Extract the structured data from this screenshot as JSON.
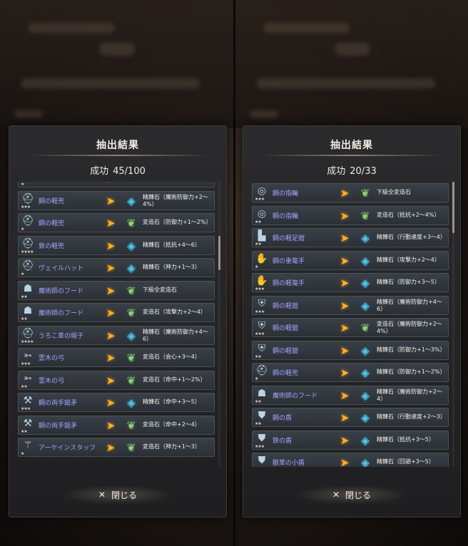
{
  "left_panel": {
    "title": "抽出結果",
    "success_label": "成功",
    "success_count": "45/100",
    "close_label": "閉じる",
    "rows": [
      {
        "icon": "helmet-icon",
        "stars": "★",
        "name": "鋼の軽兜",
        "mat": "plant",
        "result": ""
      },
      {
        "icon": "helmet-icon",
        "stars": "★★★",
        "name": "鋼の軽兜",
        "mat": "gem",
        "result": "精錬石（魔術防御力+2～4%）"
      },
      {
        "icon": "helmet-icon",
        "stars": "★",
        "name": "鋼の軽兜",
        "mat": "plant",
        "result": "変造石（防御力+1～2%）"
      },
      {
        "icon": "helmet-icon",
        "stars": "★★★★",
        "name": "鉄の軽兜",
        "mat": "gem",
        "result": "精錬石（抵抗+4～6）"
      },
      {
        "icon": "helmet-icon",
        "stars": "★",
        "name": "ヴェイルハット",
        "mat": "gem",
        "result": "精錬石（神力+1～3）"
      },
      {
        "icon": "hood-icon",
        "stars": "★★",
        "name": "魔術師のフード",
        "mat": "plant",
        "result": "下級全変造石"
      },
      {
        "icon": "hood-icon",
        "stars": "★★",
        "name": "魔術師のフード",
        "mat": "plant",
        "result": "変造石（攻撃力+2～4）"
      },
      {
        "icon": "hat-icon",
        "stars": "★★★★",
        "name": "うろこ革の帽子",
        "mat": "gem",
        "result": "精錬石（魔術防御力+4～6）"
      },
      {
        "icon": "bow-icon",
        "stars": "★★★",
        "name": "霊木の弓",
        "mat": "plant",
        "result": "変造石（会心+3～4）"
      },
      {
        "icon": "bow-icon",
        "stars": "★★",
        "name": "霊木の弓",
        "mat": "plant",
        "result": "変造石（命中+1～2%）"
      },
      {
        "icon": "axe-icon",
        "stars": "★★★",
        "name": "鋼の両手鎚矛",
        "mat": "gem",
        "result": "精錬石（命中+3～5）"
      },
      {
        "icon": "axe-icon",
        "stars": "★★",
        "name": "鋼の両手鎚矛",
        "mat": "plant",
        "result": "変造石（命中+2～4）"
      },
      {
        "icon": "staff-icon",
        "stars": "★",
        "name": "アーケインスタッフ",
        "mat": "plant",
        "result": "変造石（神力+1～3）"
      }
    ]
  },
  "right_panel": {
    "title": "抽出結果",
    "success_label": "成功",
    "success_count": "20/33",
    "close_label": "閉じる",
    "rows": [
      {
        "icon": "ring-icon",
        "stars": "★★★",
        "name": "鋼の指輪",
        "mat": "plant",
        "result": "下級全変造石"
      },
      {
        "icon": "ring-icon",
        "stars": "★★",
        "name": "鋼の指輪",
        "mat": "plant",
        "result": "変造石（抵抗+2～4%）"
      },
      {
        "icon": "boots-icon",
        "stars": "★★",
        "name": "鋼の軽足鎧",
        "mat": "gem",
        "result": "精錬石（行動速度+3～4）"
      },
      {
        "icon": "gauntlet-icon",
        "stars": "★",
        "name": "鋼の重篭手",
        "mat": "gem",
        "result": "精錬石（攻撃力+2～4）"
      },
      {
        "icon": "gauntlet-icon",
        "stars": "★★★",
        "name": "鋼の軽篭手",
        "mat": "gem",
        "result": "精錬石（防御力+3～5）"
      },
      {
        "icon": "armor-icon",
        "stars": "★★★",
        "name": "鋼の軽鎧",
        "mat": "gem",
        "result": "精錬石（魔術防御力+4～6）"
      },
      {
        "icon": "armor-icon",
        "stars": "★★★",
        "name": "鋼の軽鎧",
        "mat": "plant",
        "result": "変造石（魔術防御力+2～4%）"
      },
      {
        "icon": "armor-icon",
        "stars": "★★",
        "name": "鋼の軽鎧",
        "mat": "gem",
        "result": "精錬石（防御力+1～3%）"
      },
      {
        "icon": "helmet-icon",
        "stars": "★",
        "name": "鋼の軽兜",
        "mat": "gem",
        "result": "精錬石（防御力+1～2%）"
      },
      {
        "icon": "hood-icon",
        "stars": "★★",
        "name": "魔術師のフード",
        "mat": "gem",
        "result": "精錬石（魔術防御力+2～4）"
      },
      {
        "icon": "shield-icon",
        "stars": "★★",
        "name": "鋼の盾",
        "mat": "gem",
        "result": "精錬石（行動速度+2～3）"
      },
      {
        "icon": "shield-icon",
        "stars": "★★★",
        "name": "鉄の盾",
        "mat": "gem",
        "result": "精錬石（抵抗+3～5）"
      },
      {
        "icon": "shield-icon",
        "stars": "★",
        "name": "獣革の小盾",
        "mat": "gem",
        "result": "精錬石（回避+3～5）"
      }
    ]
  },
  "colors": {
    "item_name": "#a7a0ff",
    "arrow": "#ffb12a",
    "gem": "#58c8e8",
    "plant": "#8fd07a"
  }
}
